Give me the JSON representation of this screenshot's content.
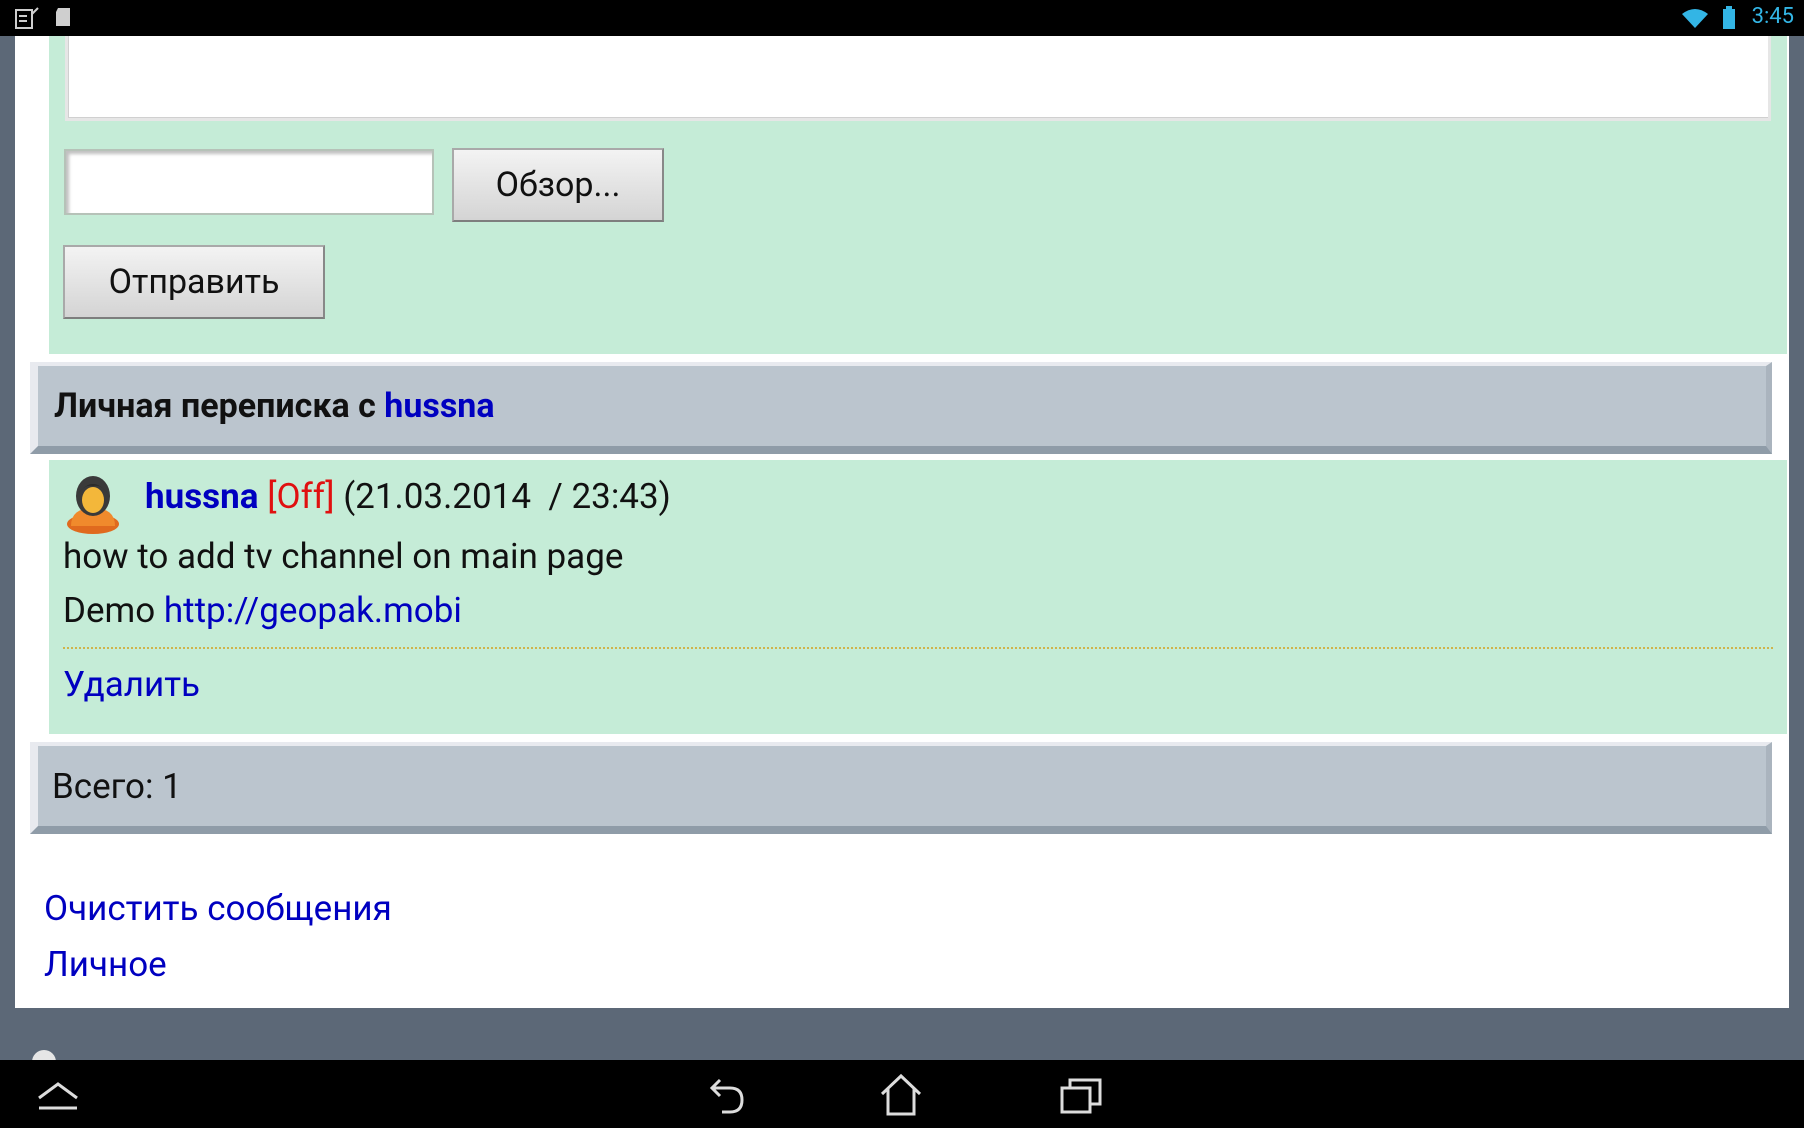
{
  "status_bar": {
    "time": "3:45",
    "icons": [
      "sim-icon",
      "sd-card-icon",
      "wifi-icon",
      "battery-icon"
    ]
  },
  "form": {
    "browse_label": "Обзор...",
    "send_label": "Отправить",
    "message_text": "",
    "file_path": ""
  },
  "conversation": {
    "header_prefix": "Личная переписка с",
    "header_user": "hussna",
    "message": {
      "username": "hussna",
      "status": "[Off]",
      "datetime": "(21.03.2014  / 23:43)",
      "line1": "how to add tv channel on main page",
      "line2_prefix": "Demo",
      "link": "http://geopak.mobi",
      "delete_label": "Удалить"
    },
    "total_label": "Всего: 1"
  },
  "links": {
    "clear_messages": "Очистить сообщения",
    "personal": "Личное"
  },
  "colors": {
    "page_bg": "#5c6877",
    "green_block": "#c5ecd7",
    "gray_band": "#bbc5ce",
    "link_blue": "#0000c0",
    "offline_red": "#e01010",
    "time_blue": "#33b5e5"
  },
  "nav_bar": {
    "buttons": [
      "up-icon",
      "back-icon",
      "home-icon",
      "recents-icon"
    ]
  }
}
